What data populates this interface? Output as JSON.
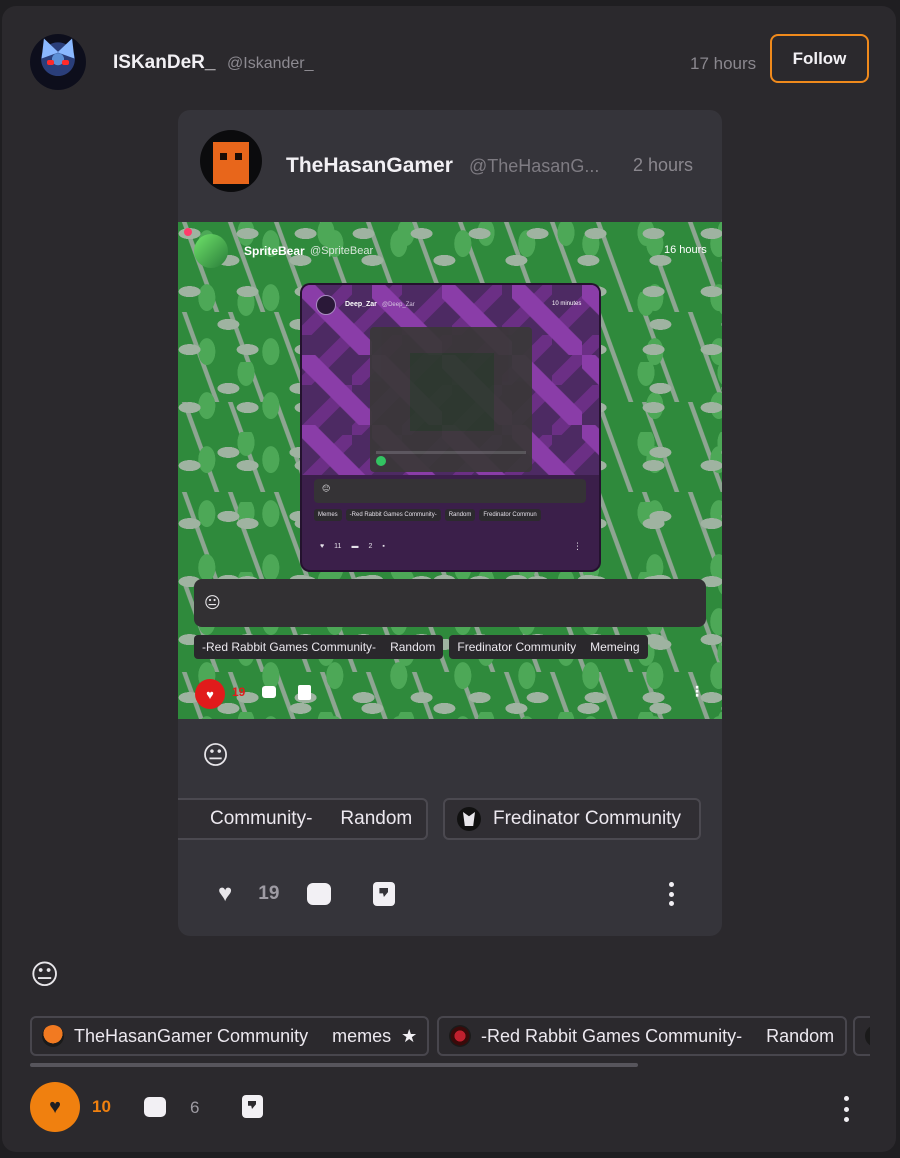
{
  "post": {
    "author_name": "ISKanDeR_",
    "author_handle": "@Iskander_",
    "time": "17 hours",
    "follow_label": "Follow",
    "emoji": "😐",
    "tags": [
      {
        "community": "TheHasanGamer Community",
        "channel": "memes",
        "icon": "star-icon"
      },
      {
        "community": "-Red Rabbit Games Community-",
        "channel": "Random"
      }
    ],
    "like_count": "10",
    "comment_count": "6",
    "accent_color": "#f0800f"
  },
  "repost": {
    "author_name": "TheHasanGamer",
    "author_handle": "@TheHasanG...",
    "time": "2 hours",
    "emoji": "😐",
    "tags": [
      {
        "community": "Community-",
        "channel": "Random"
      },
      {
        "community": "Fredinator Community"
      }
    ],
    "like_count": "19"
  },
  "screenshot": {
    "author_name": "SpriteBear",
    "author_handle": "@SpriteBear",
    "time": "16 hours",
    "emoji": "😐",
    "tags": [
      {
        "community": "-Red Rabbit Games Community-",
        "channel": "Random"
      },
      {
        "community": "Fredinator Community",
        "channel": "Memeing"
      }
    ],
    "like_count": "19",
    "inner": {
      "author_name": "Deep_Zar",
      "author_handle": "@Deep_Zar",
      "time": "10 minutes",
      "emoji": "😐",
      "tags": [
        "Memes",
        "-Red Rabbit Games Community-",
        "Random",
        "Fredinator Commun"
      ],
      "like_count": "11",
      "comment_count": "2"
    }
  }
}
